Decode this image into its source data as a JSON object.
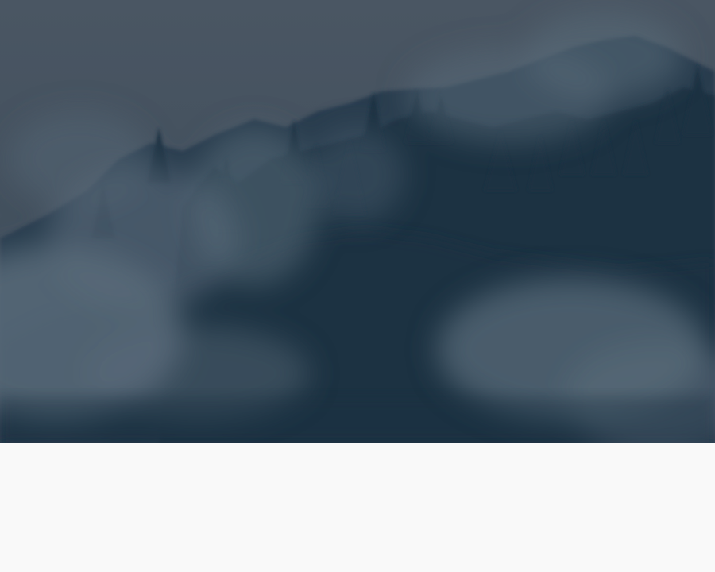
{
  "hero_image": {
    "subject": "misty-forest",
    "colors": {
      "sky_top": "#4a5663",
      "sky_bottom": "#3c4b59",
      "forest_dark": "#1e3142",
      "forest_mid": "#263b4d",
      "mist": "#5a6b7a"
    }
  },
  "page": {
    "background": "#f9f9f9"
  }
}
